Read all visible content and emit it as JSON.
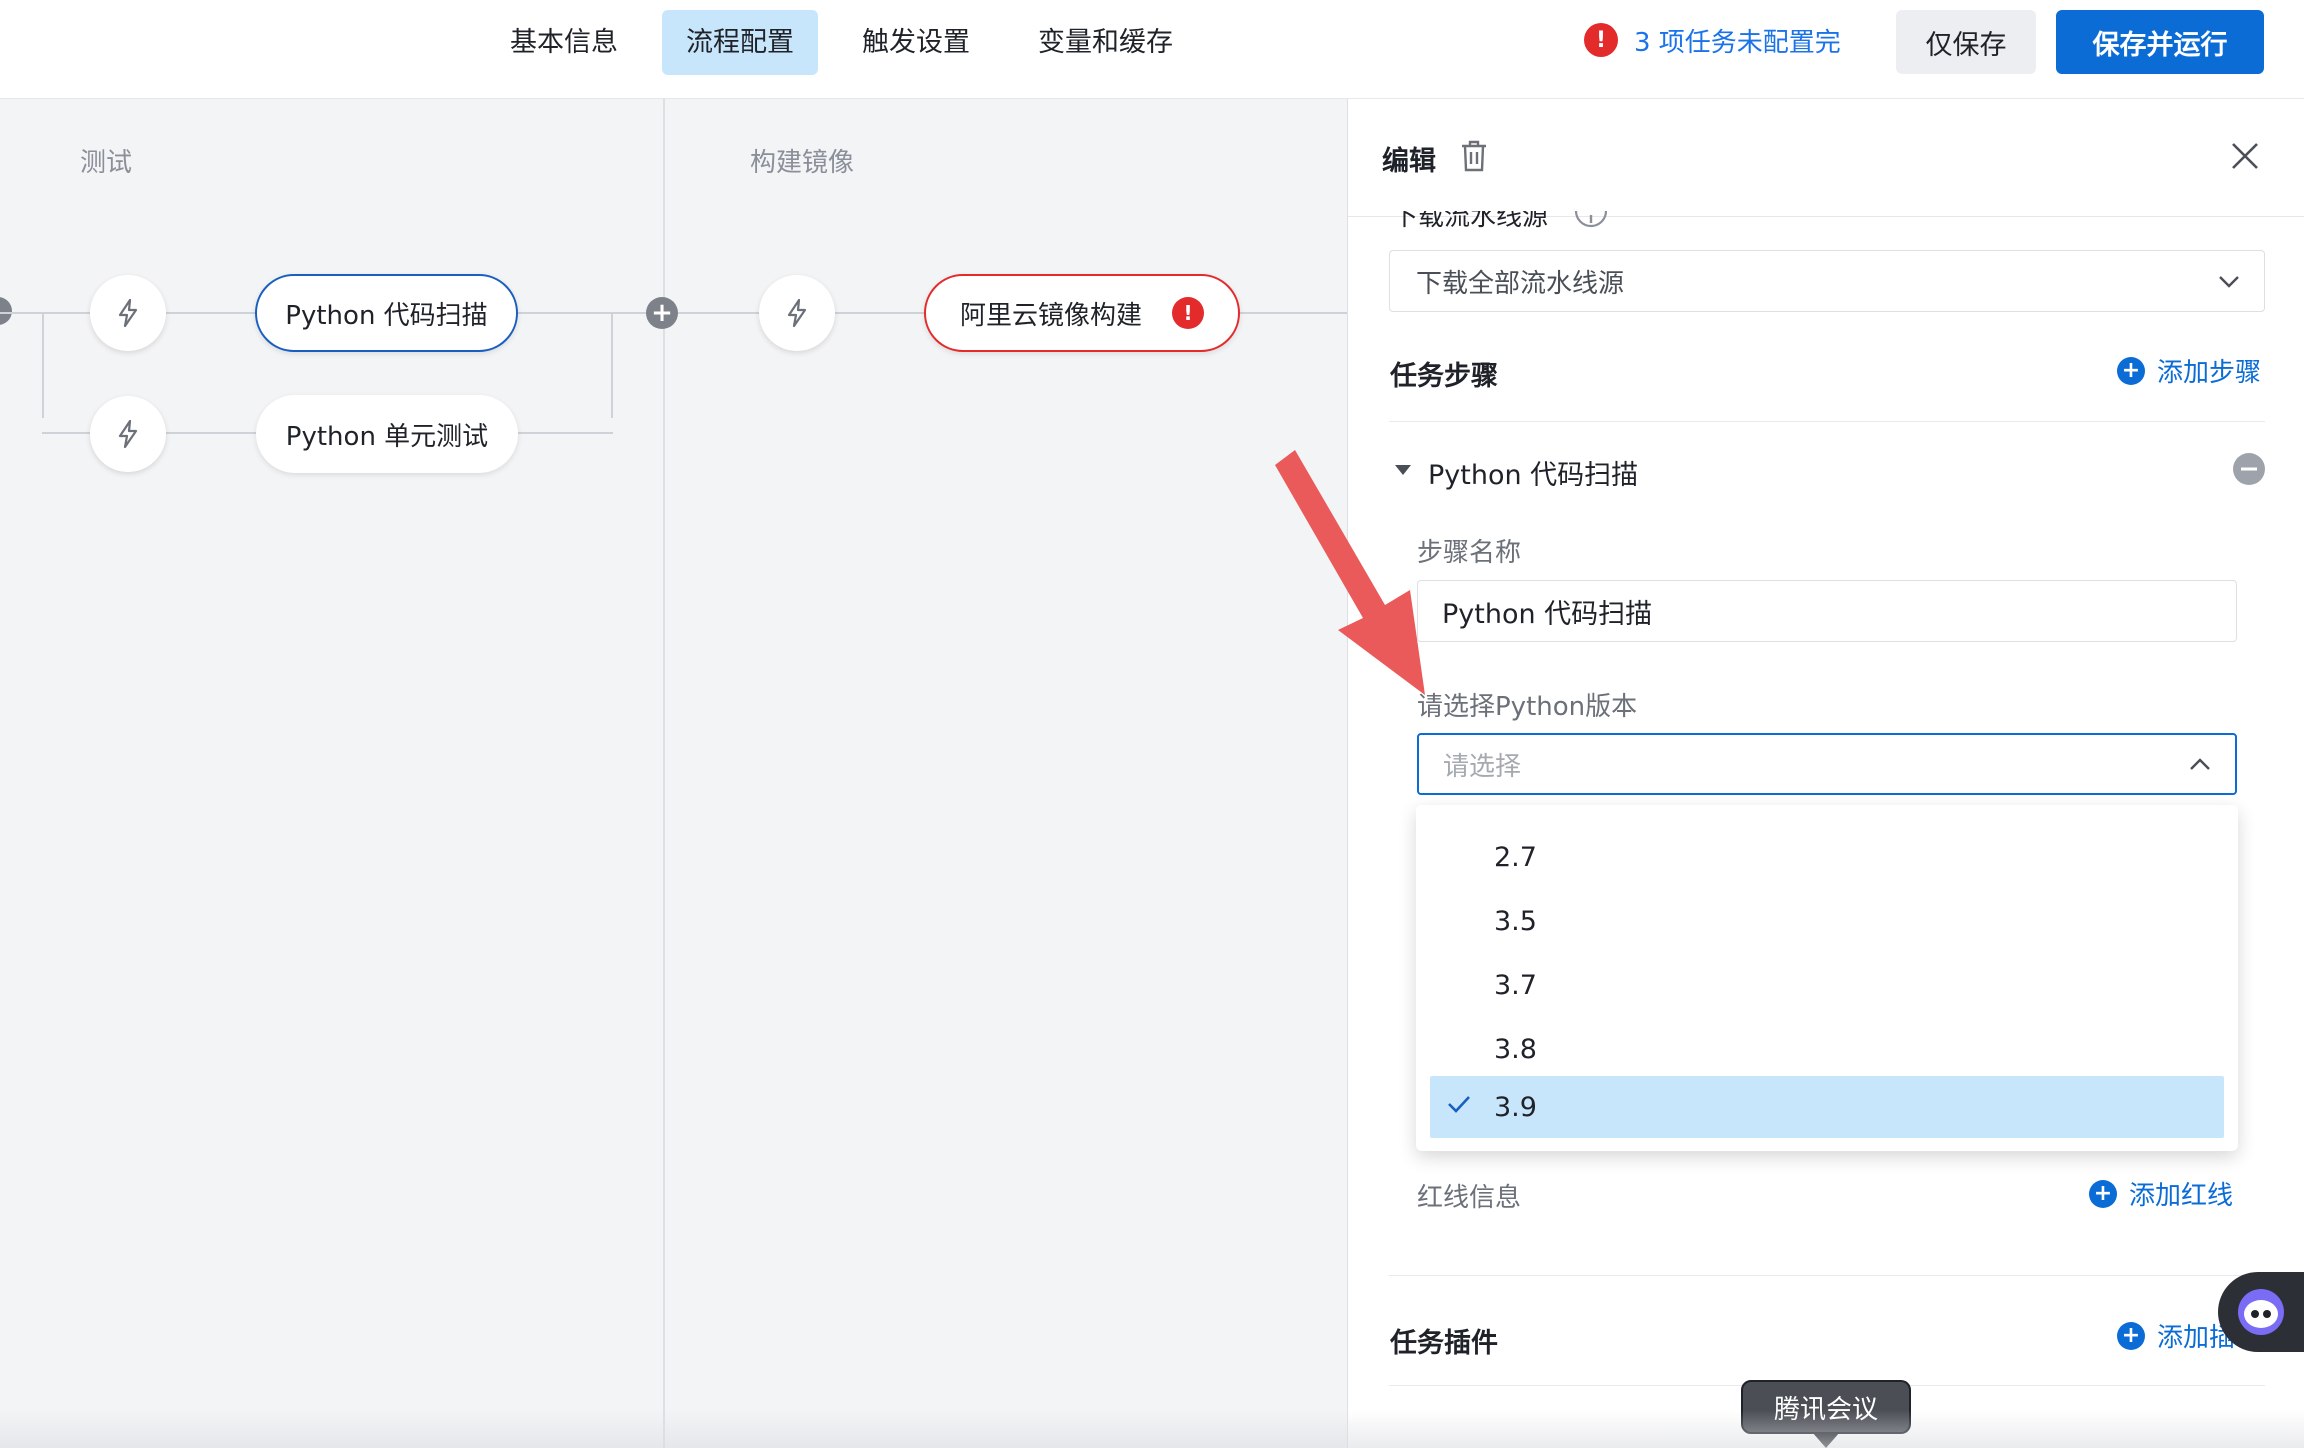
{
  "top_tabs": [
    {
      "label": "基本信息"
    },
    {
      "label": "流程配置"
    },
    {
      "label": "触发设置"
    },
    {
      "label": "变量和缓存"
    }
  ],
  "warning_text": "3 项任务未配置完",
  "buttons": {
    "save_only": "仅保存",
    "save_run": "保存并运行"
  },
  "stages": [
    {
      "title": "测试",
      "jobs": [
        "Python 代码扫描",
        "Python 单元测试"
      ]
    },
    {
      "title": "构建镜像",
      "jobs": [
        "阿里云镜像构建"
      ]
    }
  ],
  "panel": {
    "title": "编辑",
    "source_label_cut": "下载流水线源",
    "source_value": "下载全部流水线源",
    "steps_title": "任务步骤",
    "add_step": "添加步骤",
    "step_name_header": "Python 代码扫描",
    "field_step_name_label": "步骤名称",
    "field_step_name_value": "Python 代码扫描",
    "field_python_label": "请选择Python版本",
    "field_python_placeholder": "请选择",
    "redline_label": "红线信息",
    "add_redline": "添加红线",
    "plugins_title": "任务插件",
    "add_plugin": "添加插"
  },
  "dropdown": {
    "options": [
      "2.7",
      "3.5",
      "3.7",
      "3.8",
      "3.9"
    ],
    "selected": "3.9"
  },
  "tooltip": "腾讯会议",
  "colors": {
    "accent": "#0b6cd6",
    "error": "#e32b2b",
    "selected_bg": "#c8e6fb",
    "arrow": "#ea5a5a"
  }
}
